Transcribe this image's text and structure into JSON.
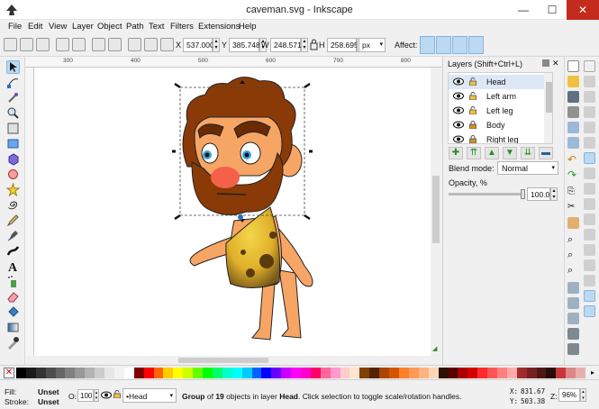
{
  "window": {
    "title": "caveman.svg - Inkscape",
    "minimize": "—",
    "maximize": "☐",
    "close": "✕"
  },
  "menu": [
    "File",
    "Edit",
    "View",
    "Layer",
    "Object",
    "Path",
    "Text",
    "Filters",
    "Extensions",
    "Help"
  ],
  "toolbar": {
    "x_label": "X",
    "x_value": "537.000",
    "y_label": "Y",
    "y_value": "385.748",
    "w_label": "W",
    "w_value": "248.571",
    "h_label": "H",
    "h_value": "258.695",
    "unit": "px",
    "affect_label": "Affect:"
  },
  "rulers": {
    "h_labels": [
      "300",
      "400",
      "500",
      "600",
      "700",
      "800"
    ]
  },
  "layers_panel": {
    "title": "Layers (Shift+Ctrl+L)",
    "layers": [
      "Head",
      "Left arm",
      "Left leg",
      "Body",
      "Right leg"
    ],
    "blend_label": "Blend mode:",
    "blend_value": "Normal",
    "opacity_label": "Opacity, %",
    "opacity_value": "100.0"
  },
  "statusbar": {
    "fill_label": "Fill:",
    "fill_value": "Unset",
    "stroke_label": "Stroke:",
    "stroke_value": "Unset",
    "opacity_label": "O:",
    "opacity_value": "100",
    "layer_value": "•Head",
    "message_prefix": "Group",
    "message_mid1": " of ",
    "message_count": "19",
    "message_mid2": " objects in layer ",
    "message_layer": "Head",
    "message_suffix": ". Click selection to toggle scale/rotation handles.",
    "x_label": "X:",
    "x_value": "831.67",
    "y_label": "Y:",
    "y_value": "503.38",
    "z_label": "Z:",
    "z_value": "96%"
  },
  "palette_colors": [
    "#000000",
    "#1a1a1a",
    "#333333",
    "#4d4d4d",
    "#666666",
    "#808080",
    "#999999",
    "#b3b3b3",
    "#cccccc",
    "#e6e6e6",
    "#f2f2f2",
    "#ffffff",
    "#800000",
    "#ff0000",
    "#ff6600",
    "#ffcc00",
    "#ffff00",
    "#ccff00",
    "#66ff00",
    "#00ff00",
    "#00ff66",
    "#00ffcc",
    "#00ffff",
    "#00ccff",
    "#0066ff",
    "#0000ff",
    "#6600ff",
    "#cc00ff",
    "#ff00ff",
    "#ff00cc",
    "#ff0066",
    "#ff6699",
    "#ff99cc",
    "#ffcccc",
    "#ffe6cc",
    "#804000",
    "#552200",
    "#aa4400",
    "#d45500",
    "#ff7f2a",
    "#ff9955",
    "#ffb380",
    "#ffd5b3",
    "#2b1100",
    "#550000",
    "#aa0000",
    "#d40000",
    "#ff2a2a",
    "#ff5555",
    "#ff8080",
    "#ffaaaa",
    "#a02c2c",
    "#782121",
    "#501616",
    "#280b0b",
    "#c83737",
    "#de8787",
    "#e9afaf"
  ]
}
